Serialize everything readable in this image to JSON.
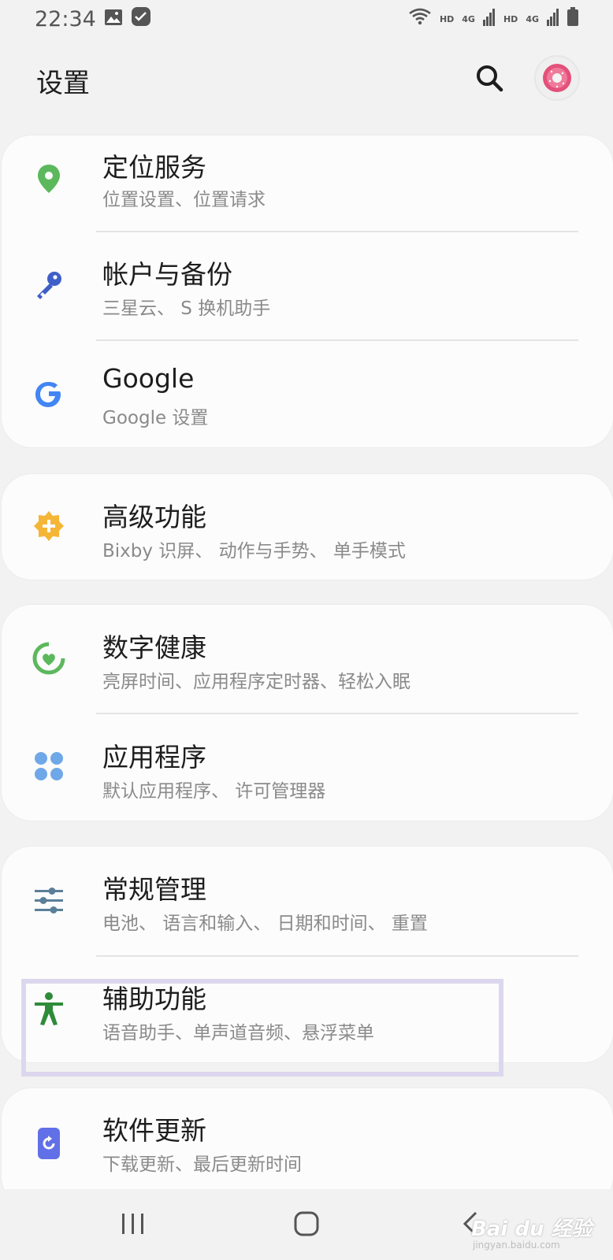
{
  "status_bar": {
    "time": "22:34",
    "net_label_1": "HD",
    "net_type_1": "4G",
    "net_label_2": "HD",
    "net_type_2": "4G",
    "icons": [
      "gallery-icon",
      "checklist-icon",
      "wifi-icon",
      "signal-icon",
      "battery-icon"
    ]
  },
  "header": {
    "title": "设置",
    "search_icon": "search-icon",
    "avatar": "avatar"
  },
  "groups": [
    {
      "items": [
        {
          "title": "定位服务",
          "subtitle": "位置设置、位置请求",
          "icon": "location-pin-icon",
          "color": "#5cb85c"
        },
        {
          "title": "帐户与备份",
          "subtitle": "三星云、 S 换机助手",
          "icon": "key-icon",
          "color": "#3f5fc8"
        },
        {
          "title": "Google",
          "subtitle": "Google 设置",
          "icon": "google-icon",
          "color": "#4285f4"
        }
      ]
    },
    {
      "items": [
        {
          "title": "高级功能",
          "subtitle": "Bixby 识屏、 动作与手势、 单手模式",
          "icon": "advanced-features-icon",
          "color": "#f5b536"
        }
      ]
    },
    {
      "items": [
        {
          "title": "数字健康",
          "subtitle": "亮屏时间、应用程序定时器、轻松入眠",
          "icon": "digital-wellbeing-icon",
          "color": "#5cb85c"
        },
        {
          "title": "应用程序",
          "subtitle": "默认应用程序、 许可管理器",
          "icon": "apps-icon",
          "color": "#6fa8e8"
        }
      ]
    },
    {
      "items": [
        {
          "title": "常规管理",
          "subtitle": "电池、 语言和输入、 日期和时间、 重置",
          "icon": "general-management-icon",
          "color": "#5b7f99"
        },
        {
          "title": "辅助功能",
          "subtitle": "语音助手、单声道音频、悬浮菜单",
          "icon": "accessibility-icon",
          "color": "#2e8b3a"
        }
      ]
    },
    {
      "items": [
        {
          "title": "软件更新",
          "subtitle": "下载更新、最后更新时间",
          "icon": "software-update-icon",
          "color": "#6170e6"
        }
      ]
    }
  ],
  "nav_bar": {
    "buttons": [
      "recent-apps-icon",
      "home-icon",
      "back-icon"
    ]
  },
  "watermark": {
    "brand": "Bai du 经验",
    "url": "jingyan.baidu.com"
  }
}
